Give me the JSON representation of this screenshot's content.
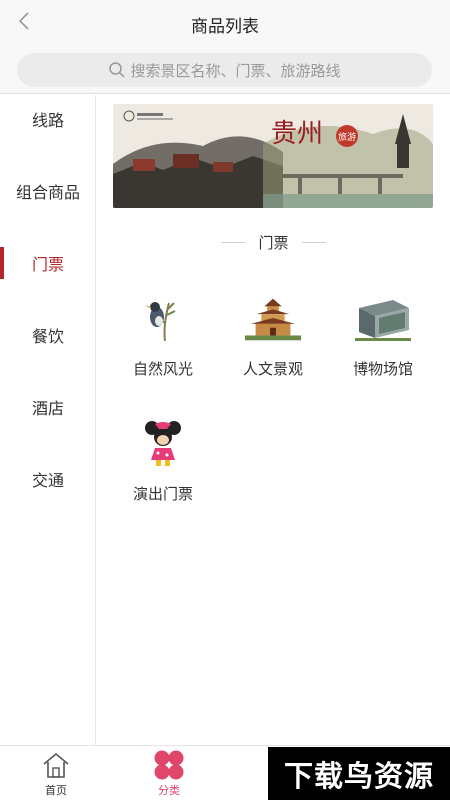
{
  "header": {
    "title": "商品列表",
    "back_icon": "chevron-left-icon"
  },
  "search": {
    "placeholder": "搜索景区名称、门票、旅游路线",
    "icon": "search-icon"
  },
  "sidebar": {
    "items": [
      {
        "label": "线路",
        "active": false
      },
      {
        "label": "组合商品",
        "active": false
      },
      {
        "label": "门票",
        "active": true
      },
      {
        "label": "餐饮",
        "active": false
      },
      {
        "label": "酒店",
        "active": false
      },
      {
        "label": "交通",
        "active": false
      }
    ]
  },
  "banner": {
    "title": "贵州",
    "badge": "旅游"
  },
  "section": {
    "title": "门票"
  },
  "categories": [
    {
      "label": "自然风光",
      "icon": "bird-on-branch-icon"
    },
    {
      "label": "人文景观",
      "icon": "pagoda-icon"
    },
    {
      "label": "博物场馆",
      "icon": "museum-building-icon"
    },
    {
      "label": "演出门票",
      "icon": "cartoon-mouse-icon"
    }
  ],
  "tabbar": {
    "items": [
      {
        "label": "首页",
        "icon": "home-icon",
        "active": false
      },
      {
        "label": "分类",
        "icon": "category-petals-icon",
        "active": true
      }
    ]
  },
  "watermark": {
    "text": "下载鸟资源"
  },
  "colors": {
    "accent": "#b5262b",
    "tab_active": "#e0456a",
    "search_bg": "#ebebeb",
    "header_bg": "#f8f8f8"
  }
}
